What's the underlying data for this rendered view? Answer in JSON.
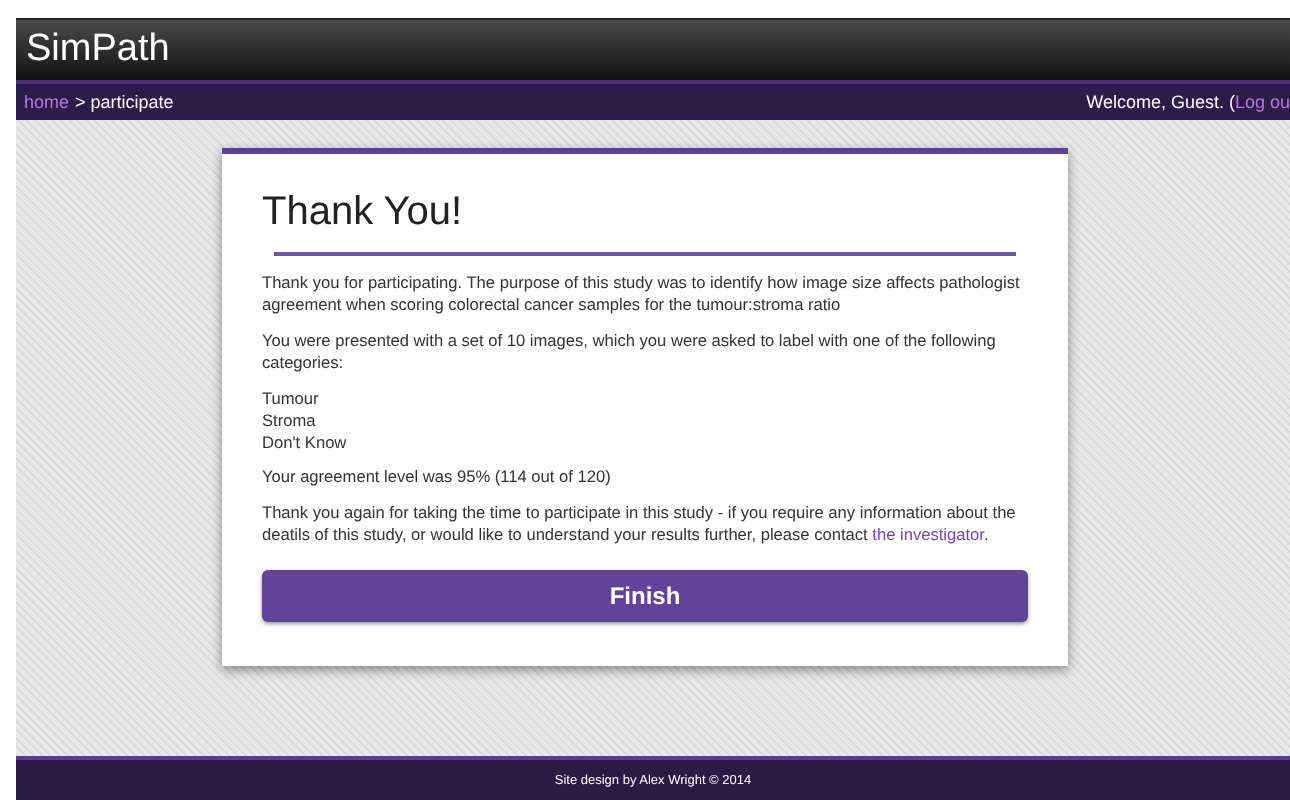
{
  "header": {
    "title": "SimPath"
  },
  "nav": {
    "breadcrumb": [
      {
        "label": "home",
        "link": true
      },
      {
        "label": "> participate",
        "link": false
      }
    ],
    "welcome": "Welcome, Guest. (",
    "logout": "Log ou"
  },
  "card": {
    "heading": "Thank You!",
    "paragraphs": [
      "Thank you for participating. The purpose of this study was to identify how image size affects pathologist agreement when scoring colorectal cancer samples for the tumour:stroma ratio",
      "You were presented with a set of 10 images, which you were asked to label with one of the following categories:"
    ],
    "categories": [
      "Tumour",
      "Stroma",
      "Don't Know"
    ],
    "agreement": "Your agreement level was 95% (114 out of 120)",
    "closing": {
      "text": "Thank you again for taking the time to participate in this study - if you require any information about the deatils of this study, or would like to understand your results further, please contact ",
      "link": "the investigator",
      "end": "."
    },
    "button": "Finish"
  },
  "footer": "Site design by Alex Wright © 2014"
}
